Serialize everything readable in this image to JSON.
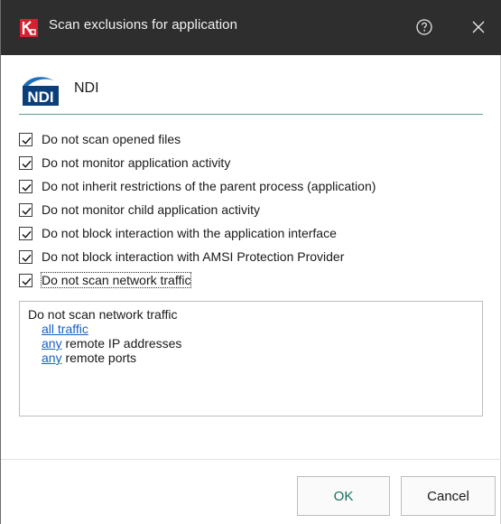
{
  "window": {
    "title": "Scan exclusions for application",
    "help_icon": "help-circle-icon",
    "close_icon": "close-icon"
  },
  "application": {
    "logo_text": "NDI",
    "name": "NDI"
  },
  "options": [
    {
      "label": "Do not scan opened files",
      "checked": true
    },
    {
      "label": "Do not monitor application activity",
      "checked": true
    },
    {
      "label": "Do not inherit restrictions of the parent process (application)",
      "checked": true
    },
    {
      "label": "Do not monitor child application activity",
      "checked": true
    },
    {
      "label": "Do not block interaction with the application interface",
      "checked": true
    },
    {
      "label": "Do not block interaction with AMSI Protection Provider",
      "checked": true
    },
    {
      "label": "Do not scan network traffic",
      "checked": true
    }
  ],
  "details": {
    "heading": "Do not scan network traffic",
    "traffic_link": "all traffic",
    "ip_link": "any",
    "ip_suffix": " remote IP addresses",
    "ports_link": "any",
    "ports_suffix": " remote ports"
  },
  "buttons": {
    "ok": "OK",
    "cancel": "Cancel"
  },
  "colors": {
    "titlebar": "#2e2e2e",
    "accent_rule": "#5f9f8f",
    "link": "#1a5fbf",
    "brand_red": "#d6202f"
  }
}
